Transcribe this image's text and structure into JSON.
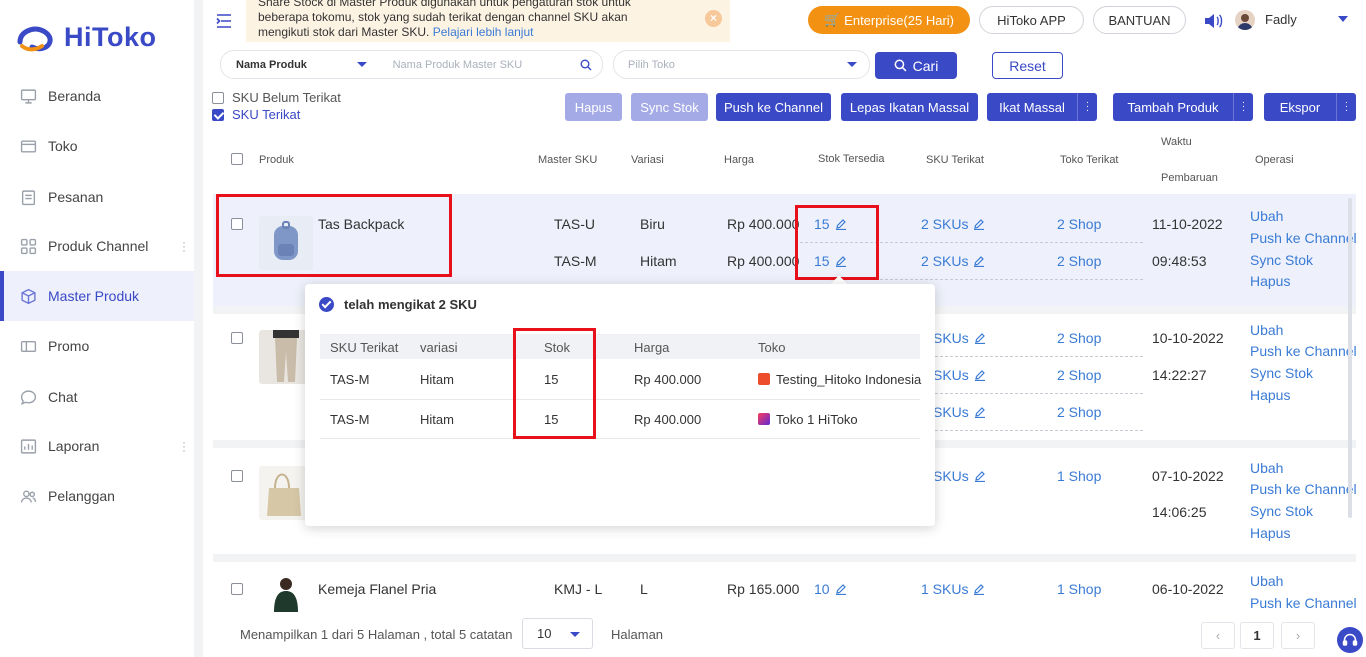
{
  "brand": {
    "name": "HiToko",
    "primary": "#3a49c6",
    "orange": "#f39212",
    "highlight": "#e8101a"
  },
  "sidebar": {
    "items": [
      {
        "label": "Beranda",
        "icon": "monitor-icon"
      },
      {
        "label": "Toko",
        "icon": "store-icon"
      },
      {
        "label": "Pesanan",
        "icon": "clipboard-icon"
      },
      {
        "label": "Produk Channel",
        "icon": "grid-icon"
      },
      {
        "label": "Master Produk",
        "icon": "cube-icon",
        "active": true
      },
      {
        "label": "Promo",
        "icon": "ticket-icon"
      },
      {
        "label": "Chat",
        "icon": "chat-icon"
      },
      {
        "label": "Laporan",
        "icon": "report-icon"
      },
      {
        "label": "Pelanggan",
        "icon": "users-icon"
      }
    ]
  },
  "topbar": {
    "notice_line1": "Share Stock di Master Produk digunakan untuk pengaturan stok untuk",
    "notice_line2": "beberapa tokomu, stok yang sudah terikat dengan channel SKU akan",
    "notice_line3": "mengikuti stok dari Master SKU.",
    "notice_link": "Pelajari lebih lanjut",
    "enterprise": "Enterprise(25 Hari)",
    "app": "HiToko APP",
    "help": "BANTUAN",
    "user": "Fadly"
  },
  "filters": {
    "type": "Nama Produk",
    "search_placeholder": "Nama Produk Master SKU",
    "shop_placeholder": "Pilih Toko",
    "search_btn": "Cari",
    "reset_btn": "Reset",
    "unbound": "SKU Belum Terikat",
    "bound": "SKU Terikat"
  },
  "actions": {
    "hapus": "Hapus",
    "sync": "Sync Stok",
    "push": "Push ke Channel",
    "lepas": "Lepas Ikatan Massal",
    "ikat": "Ikat Massal",
    "tambah": "Tambah Produk",
    "ekspor": "Ekspor"
  },
  "table": {
    "headers": {
      "produk": "Produk",
      "master_sku": "Master SKU",
      "variasi": "Variasi",
      "harga": "Harga",
      "stok": "Stok Tersedia",
      "sku_terikat": "SKU Terikat",
      "toko_terikat": "Toko Terikat",
      "waktu1": "Waktu",
      "waktu2": "Pembaruan",
      "operasi": "Operasi"
    },
    "ops": [
      "Ubah",
      "Push ke Channel",
      "Sync Stok",
      "Hapus"
    ],
    "rows": [
      {
        "name": "Tas Backpack",
        "date": "11-10-2022",
        "time": "09:48:53",
        "skus": [
          {
            "sku": "TAS-U",
            "var": "Biru",
            "price": "Rp 400.000",
            "stock": "15",
            "bound": "2 SKUs",
            "shops": "2 Shop"
          },
          {
            "sku": "TAS-M",
            "var": "Hitam",
            "price": "Rp 400.000",
            "stock": "15",
            "bound": "2 SKUs",
            "shops": "2 Shop"
          }
        ]
      },
      {
        "date": "10-10-2022",
        "time": "14:22:27",
        "skus": [
          {
            "bound": "SKUs",
            "shops": "2 Shop"
          },
          {
            "bound": "SKUs",
            "shops": "2 Shop"
          },
          {
            "bound": "SKUs",
            "shops": "2 Shop"
          }
        ]
      },
      {
        "date": "07-10-2022",
        "time": "14:06:25",
        "skus": [
          {
            "bound": "SKUs",
            "shops": "1 Shop"
          }
        ]
      },
      {
        "name": "Kemeja Flanel Pria",
        "date": "06-10-2022",
        "skus": [
          {
            "sku": "KMJ - L",
            "var": "L",
            "price": "Rp 165.000",
            "stock": "10",
            "bound": "1 SKUs",
            "shops": "1 Shop"
          }
        ]
      }
    ]
  },
  "popup": {
    "title": "telah mengikat 2 SKU",
    "headers": {
      "sku": "SKU Terikat",
      "var": "variasi",
      "stok": "Stok",
      "harga": "Harga",
      "toko": "Toko"
    },
    "rows": [
      {
        "sku": "TAS-M",
        "var": "Hitam",
        "stok": "15",
        "harga": "Rp 400.000",
        "toko": "Testing_Hitoko Indonesia",
        "shop_color": "#ee4d2d"
      },
      {
        "sku": "TAS-M",
        "var": "Hitam",
        "stok": "15",
        "harga": "Rp 400.000",
        "toko": "Toko 1 HiToko",
        "shop_color": "#5b2bd6"
      }
    ]
  },
  "footer": {
    "summary": "Menampilkan 1 dari 5 Halaman , total 5 catatan",
    "page_size": "10",
    "halaman": "Halaman",
    "current_page": "1",
    "prev": "‹",
    "next": "›"
  }
}
